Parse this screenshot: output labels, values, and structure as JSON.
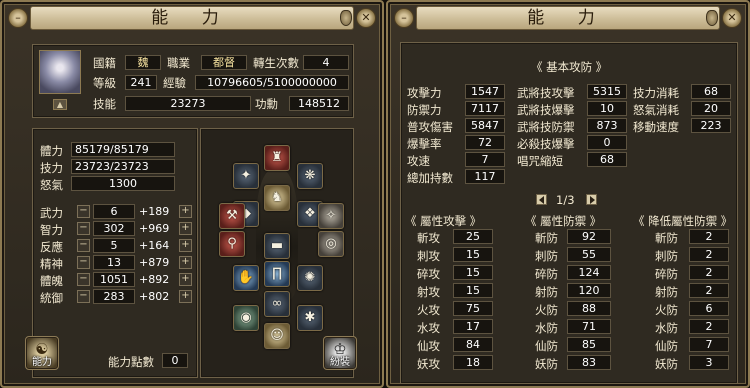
{
  "left": {
    "title": "能 力",
    "profile": {
      "country_label": "國籍",
      "country_value": "魏",
      "job_label": "職業",
      "job_value": "都督",
      "rebirth_label": "轉生次數",
      "rebirth_value": "4",
      "level_label": "等級",
      "level_value": "241",
      "exp_label": "經驗",
      "exp_value": "10796605/5100000000",
      "skill_label": "技能",
      "skill_value": "23273",
      "merit_label": "功勳",
      "merit_value": "148512"
    },
    "vitals": [
      {
        "label": "體力",
        "value": "85179/85179"
      },
      {
        "label": "技力",
        "value": "23723/23723"
      },
      {
        "label": "怒氣",
        "value": "1300"
      }
    ],
    "stats": [
      {
        "label": "武力",
        "value": "6",
        "bonus": "+189"
      },
      {
        "label": "智力",
        "value": "302",
        "bonus": "+969"
      },
      {
        "label": "反應",
        "value": "5",
        "bonus": "+164"
      },
      {
        "label": "精神",
        "value": "13",
        "bonus": "+879"
      },
      {
        "label": "體魄",
        "value": "1051",
        "bonus": "+892"
      },
      {
        "label": "統御",
        "value": "283",
        "bonus": "+802"
      }
    ],
    "stepper_minus": "−",
    "stepper_plus": "+",
    "points_label": "能力點數",
    "points_value": "0",
    "ability_button": "能力",
    "outfit_button": "紛裝"
  },
  "right": {
    "title": "能 力",
    "section_title": "《 基本攻防 》",
    "col1": [
      {
        "label": "攻擊力",
        "value": "1547"
      },
      {
        "label": "防禦力",
        "value": "7117"
      },
      {
        "label": "普攻傷害",
        "value": "5847"
      },
      {
        "label": "爆擊率",
        "value": "72"
      },
      {
        "label": "攻速",
        "value": "7"
      },
      {
        "label": "總加持數",
        "value": "117"
      }
    ],
    "col2": [
      {
        "label": "武將技攻擊",
        "value": "5315"
      },
      {
        "label": "武將技爆擊",
        "value": "10"
      },
      {
        "label": "武將技防禦",
        "value": "873"
      },
      {
        "label": "必殺技爆擊",
        "value": "0"
      },
      {
        "label": "唱咒縮短",
        "value": "68"
      }
    ],
    "col3": [
      {
        "label": "技力消耗",
        "value": "68"
      },
      {
        "label": "怒氣消耗",
        "value": "20"
      },
      {
        "label": "移動速度",
        "value": "223"
      }
    ],
    "page_indicator": "1/3",
    "attr_attack": {
      "title": "《 屬性攻擊 》",
      "rows": [
        {
          "label": "斬攻",
          "value": "25"
        },
        {
          "label": "刺攻",
          "value": "15"
        },
        {
          "label": "碎攻",
          "value": "15"
        },
        {
          "label": "射攻",
          "value": "15"
        },
        {
          "label": "火攻",
          "value": "75"
        },
        {
          "label": "水攻",
          "value": "17"
        },
        {
          "label": "仙攻",
          "value": "84"
        },
        {
          "label": "妖攻",
          "value": "18"
        }
      ]
    },
    "attr_defense": {
      "title": "《 屬性防禦 》",
      "rows": [
        {
          "label": "斬防",
          "value": "92"
        },
        {
          "label": "刺防",
          "value": "55"
        },
        {
          "label": "碎防",
          "value": "124"
        },
        {
          "label": "射防",
          "value": "120"
        },
        {
          "label": "火防",
          "value": "88"
        },
        {
          "label": "水防",
          "value": "71"
        },
        {
          "label": "仙防",
          "value": "85"
        },
        {
          "label": "妖防",
          "value": "83"
        }
      ]
    },
    "attr_reduce": {
      "title": "《 降低屬性防禦 》",
      "rows": [
        {
          "label": "斬防",
          "value": "2"
        },
        {
          "label": "刺防",
          "value": "2"
        },
        {
          "label": "碎防",
          "value": "2"
        },
        {
          "label": "射防",
          "value": "2"
        },
        {
          "label": "火防",
          "value": "6"
        },
        {
          "label": "水防",
          "value": "2"
        },
        {
          "label": "仙防",
          "value": "7"
        },
        {
          "label": "妖防",
          "value": "3"
        }
      ]
    }
  },
  "icons": {
    "close": "close-icon",
    "minimize": "minimize-icon"
  }
}
